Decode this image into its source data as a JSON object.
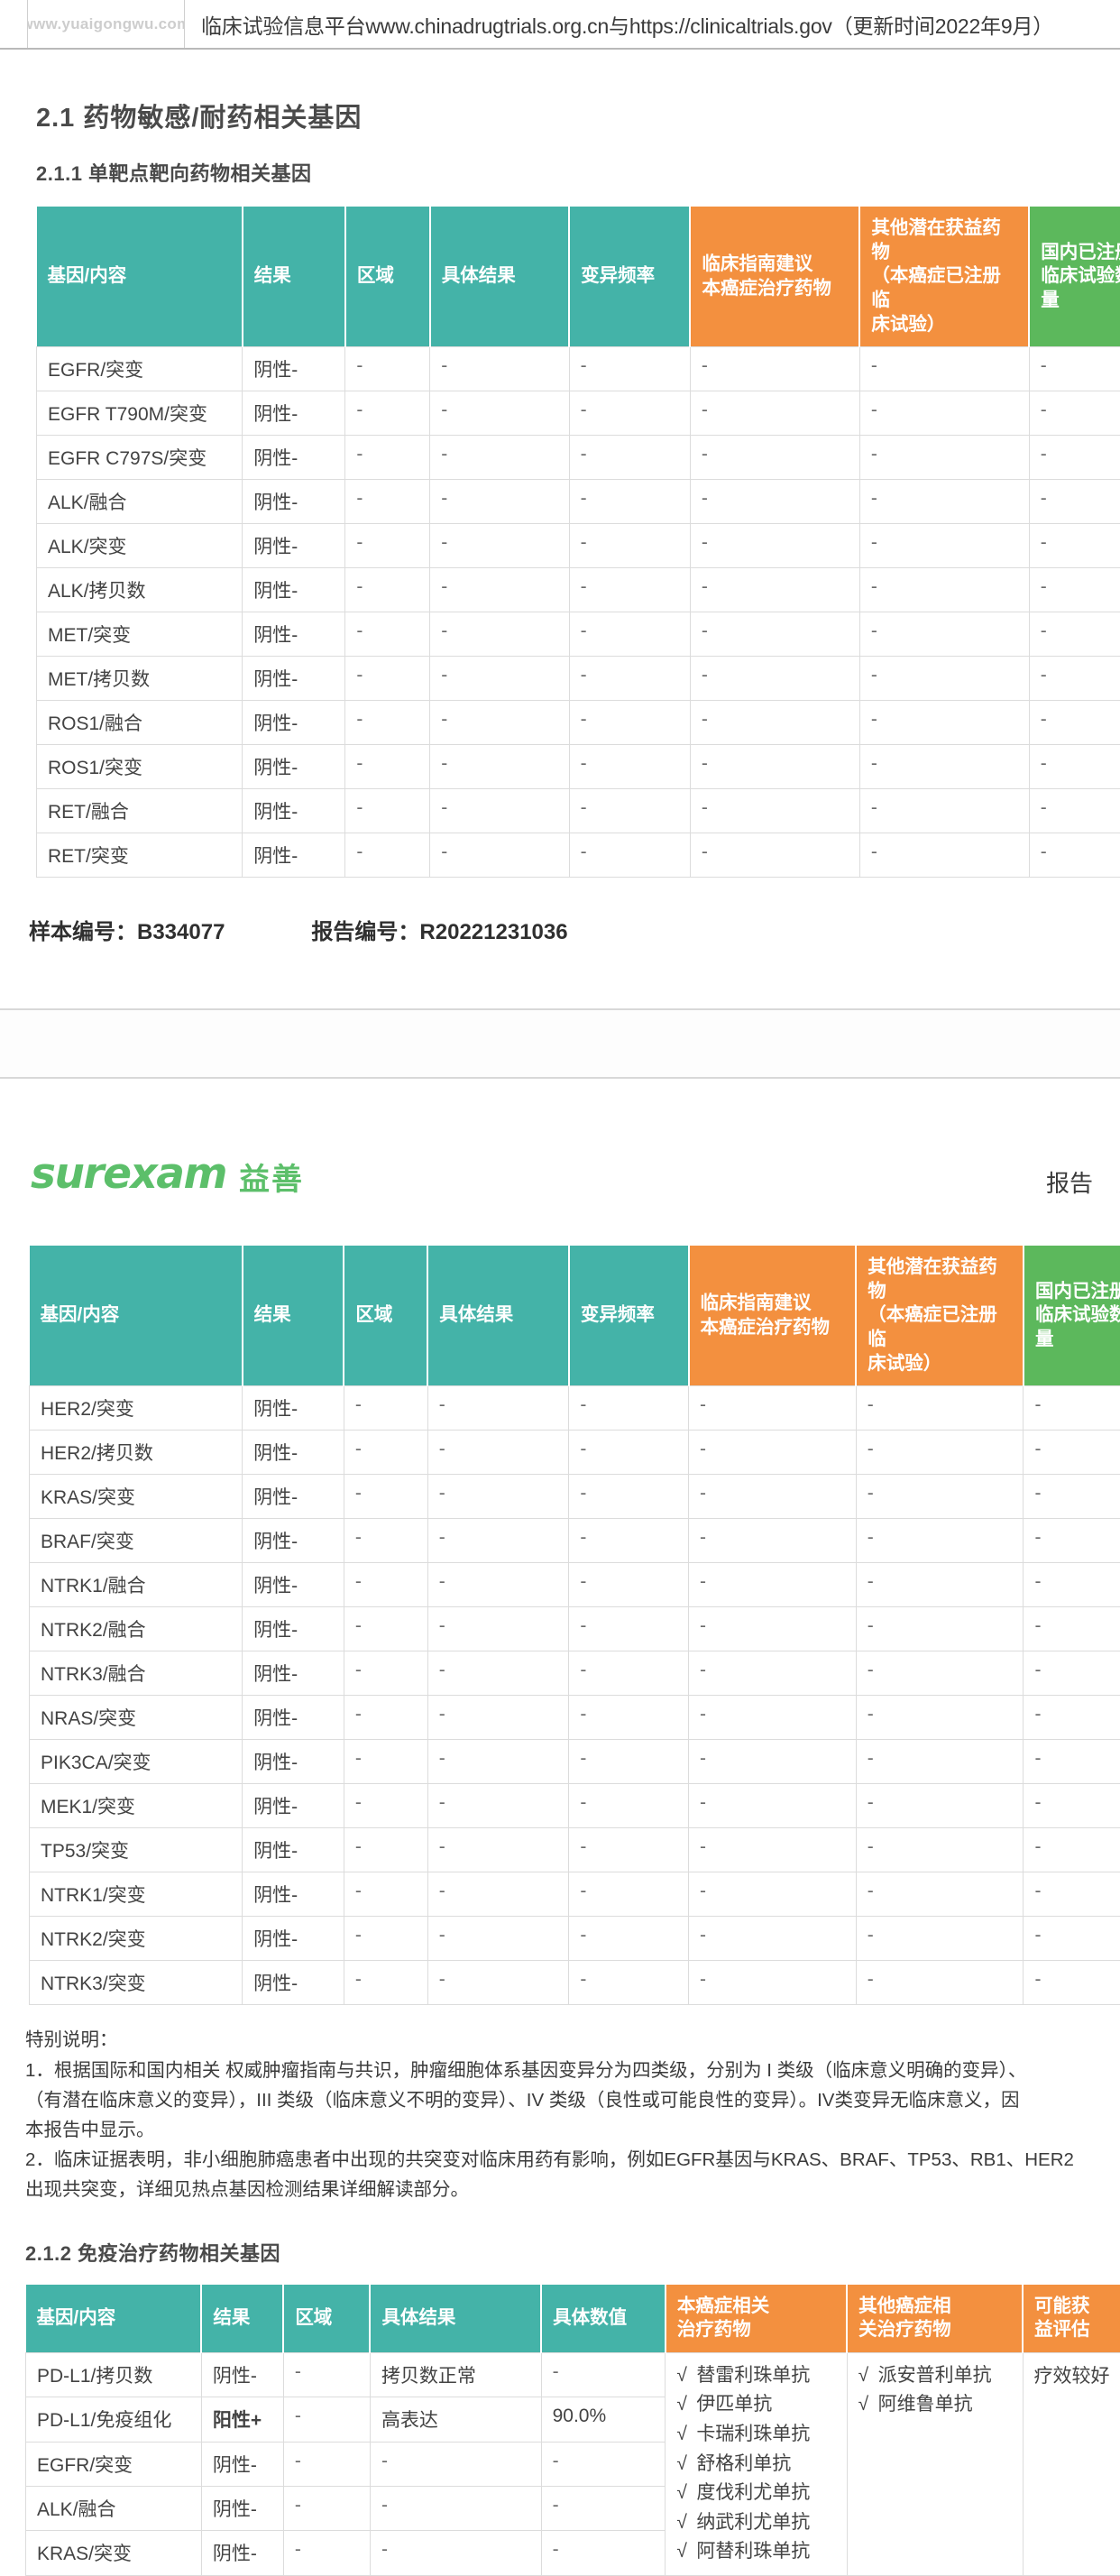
{
  "running_header": {
    "watermark": "www.yuaigongwu.com",
    "text": "临床试验信息平台www.chinadrugtrials.org.cn与https://clinicaltrials.gov（更新时间2022年9月）"
  },
  "section_2_1": {
    "title": "2.1  药物敏感/耐药相关基因",
    "subsection_title": "2.1.1  单靶点靶向药物相关基因",
    "columns": [
      "基因/内容",
      "结果",
      "区域",
      "具体结果",
      "变异频率",
      "临床指南建议\n本癌症治疗药物",
      "其他潜在获益药物（本癌症已注册临床试验）",
      "国内已注册\n临床试验数量"
    ],
    "column_labels": {
      "gene": "基因/内容",
      "result": "结果",
      "region": "区域",
      "detail": "具体结果",
      "freq": "变异频率",
      "guideline_l1": "临床指南建议",
      "guideline_l2": "本癌症治疗药物",
      "other_l1": "其他潜在获益药物",
      "other_l2": "（本癌症已注册临",
      "other_l3": "床试验）",
      "trials_l1": "国内已注册",
      "trials_l2": "临床试验数量"
    },
    "rows": [
      {
        "gene": "EGFR/突变",
        "result": "阴性-",
        "region": "-",
        "detail": "-",
        "freq": "-",
        "guideline": "-",
        "other": "-",
        "trials": "-"
      },
      {
        "gene": "EGFR T790M/突变",
        "result": "阴性-",
        "region": "-",
        "detail": "-",
        "freq": "-",
        "guideline": "-",
        "other": "-",
        "trials": "-"
      },
      {
        "gene": "EGFR C797S/突变",
        "result": "阴性-",
        "region": "-",
        "detail": "-",
        "freq": "-",
        "guideline": "-",
        "other": "-",
        "trials": "-"
      },
      {
        "gene": "ALK/融合",
        "result": "阴性-",
        "region": "-",
        "detail": "-",
        "freq": "-",
        "guideline": "-",
        "other": "-",
        "trials": "-"
      },
      {
        "gene": "ALK/突变",
        "result": "阴性-",
        "region": "-",
        "detail": "-",
        "freq": "-",
        "guideline": "-",
        "other": "-",
        "trials": "-"
      },
      {
        "gene": "ALK/拷贝数",
        "result": "阴性-",
        "region": "-",
        "detail": "-",
        "freq": "-",
        "guideline": "-",
        "other": "-",
        "trials": "-"
      },
      {
        "gene": "MET/突变",
        "result": "阴性-",
        "region": "-",
        "detail": "-",
        "freq": "-",
        "guideline": "-",
        "other": "-",
        "trials": "-"
      },
      {
        "gene": "MET/拷贝数",
        "result": "阴性-",
        "region": "-",
        "detail": "-",
        "freq": "-",
        "guideline": "-",
        "other": "-",
        "trials": "-"
      },
      {
        "gene": "ROS1/融合",
        "result": "阴性-",
        "region": "-",
        "detail": "-",
        "freq": "-",
        "guideline": "-",
        "other": "-",
        "trials": "-"
      },
      {
        "gene": "ROS1/突变",
        "result": "阴性-",
        "region": "-",
        "detail": "-",
        "freq": "-",
        "guideline": "-",
        "other": "-",
        "trials": "-"
      },
      {
        "gene": "RET/融合",
        "result": "阴性-",
        "region": "-",
        "detail": "-",
        "freq": "-",
        "guideline": "-",
        "other": "-",
        "trials": "-"
      },
      {
        "gene": "RET/突变",
        "result": "阴性-",
        "region": "-",
        "detail": "-",
        "freq": "-",
        "guideline": "-",
        "other": "-",
        "trials": "-"
      }
    ]
  },
  "ids": {
    "sample_label": "样本编号：",
    "sample_value": "B334077",
    "report_label": "报告编号：",
    "report_value": "R20221231036"
  },
  "brand": {
    "logo": "surexam",
    "logo_cn": "益善",
    "right_text": "报告"
  },
  "section_2_1_cont": {
    "rows": [
      {
        "gene": "HER2/突变",
        "result": "阴性-",
        "region": "-",
        "detail": "-",
        "freq": "-",
        "guideline": "-",
        "other": "-",
        "trials": "-"
      },
      {
        "gene": "HER2/拷贝数",
        "result": "阴性-",
        "region": "-",
        "detail": "-",
        "freq": "-",
        "guideline": "-",
        "other": "-",
        "trials": "-"
      },
      {
        "gene": "KRAS/突变",
        "result": "阴性-",
        "region": "-",
        "detail": "-",
        "freq": "-",
        "guideline": "-",
        "other": "-",
        "trials": "-"
      },
      {
        "gene": "BRAF/突变",
        "result": "阴性-",
        "region": "-",
        "detail": "-",
        "freq": "-",
        "guideline": "-",
        "other": "-",
        "trials": "-"
      },
      {
        "gene": "NTRK1/融合",
        "result": "阴性-",
        "region": "-",
        "detail": "-",
        "freq": "-",
        "guideline": "-",
        "other": "-",
        "trials": "-"
      },
      {
        "gene": "NTRK2/融合",
        "result": "阴性-",
        "region": "-",
        "detail": "-",
        "freq": "-",
        "guideline": "-",
        "other": "-",
        "trials": "-"
      },
      {
        "gene": "NTRK3/融合",
        "result": "阴性-",
        "region": "-",
        "detail": "-",
        "freq": "-",
        "guideline": "-",
        "other": "-",
        "trials": "-"
      },
      {
        "gene": "NRAS/突变",
        "result": "阴性-",
        "region": "-",
        "detail": "-",
        "freq": "-",
        "guideline": "-",
        "other": "-",
        "trials": "-"
      },
      {
        "gene": "PIK3CA/突变",
        "result": "阴性-",
        "region": "-",
        "detail": "-",
        "freq": "-",
        "guideline": "-",
        "other": "-",
        "trials": "-"
      },
      {
        "gene": "MEK1/突变",
        "result": "阴性-",
        "region": "-",
        "detail": "-",
        "freq": "-",
        "guideline": "-",
        "other": "-",
        "trials": "-"
      },
      {
        "gene": "TP53/突变",
        "result": "阴性-",
        "region": "-",
        "detail": "-",
        "freq": "-",
        "guideline": "-",
        "other": "-",
        "trials": "-"
      },
      {
        "gene": "NTRK1/突变",
        "result": "阴性-",
        "region": "-",
        "detail": "-",
        "freq": "-",
        "guideline": "-",
        "other": "-",
        "trials": "-"
      },
      {
        "gene": "NTRK2/突变",
        "result": "阴性-",
        "region": "-",
        "detail": "-",
        "freq": "-",
        "guideline": "-",
        "other": "-",
        "trials": "-"
      },
      {
        "gene": "NTRK3/突变",
        "result": "阴性-",
        "region": "-",
        "detail": "-",
        "freq": "-",
        "guideline": "-",
        "other": "-",
        "trials": "-"
      }
    ]
  },
  "notes": {
    "title": "特别说明：",
    "item1_l1": "1．根据国际和国内相关 权威肿瘤指南与共识，肿瘤细胞体系基因变异分为四类级，分别为 I 类级（临床意义明确的变异）、",
    "item1_l2": "（有潜在临床意义的变异），III 类级（临床意义不明的变异）、IV 类级（良性或可能良性的变异）。IV类变异无临床意义，因",
    "item1_l3": "本报告中显示。",
    "item2_l1": "2．临床证据表明，非小细胞肺癌患者中出现的共突变对临床用药有影响，例如EGFR基因与KRAS、BRAF、TP53、RB1、HER2",
    "item2_l2": "出现共突变，详细见热点基因检测结果详细解读部分。"
  },
  "section_2_1_2": {
    "title": "2.1.2  免疫治疗药物相关基因",
    "column_labels": {
      "gene": "基因/内容",
      "result": "结果",
      "region": "区域",
      "detail": "具体结果",
      "value": "具体数值",
      "this_cancer_l1": "本癌症相关",
      "this_cancer_l2": "治疗药物",
      "other_cancer_l1": "其他癌症相",
      "other_cancer_l2": "关治疗药物",
      "benefit_l1": "可能获",
      "benefit_l2": "益评估"
    },
    "rows": [
      {
        "gene": "PD-L1/拷贝数",
        "result": "阴性-",
        "result_positive": false,
        "region": "-",
        "detail": "拷贝数正常",
        "value": "-"
      },
      {
        "gene": "PD-L1/免疫组化",
        "result": "阳性+",
        "result_positive": true,
        "region": "-",
        "detail": "高表达",
        "value": "90.0%"
      },
      {
        "gene": "EGFR/突变",
        "result": "阴性-",
        "result_positive": false,
        "region": "-",
        "detail": "-",
        "value": "-"
      },
      {
        "gene": "ALK/融合",
        "result": "阴性-",
        "result_positive": false,
        "region": "-",
        "detail": "-",
        "value": "-"
      },
      {
        "gene": "KRAS/突变",
        "result": "阴性-",
        "result_positive": false,
        "region": "-",
        "detail": "-",
        "value": "-"
      }
    ],
    "this_cancer_drugs": [
      "替雷利珠单抗",
      "伊匹单抗",
      "卡瑞利珠单抗",
      "舒格利单抗",
      "度伐利尤单抗",
      "纳武利尤单抗",
      "阿替利珠单抗"
    ],
    "other_cancer_drugs": [
      "派安普利单抗",
      "阿维鲁单抗"
    ],
    "benefit": "疗效较好",
    "check_mark": "√"
  },
  "colors": {
    "teal": "#44b3a8",
    "orange": "#f3903f",
    "green": "#5cb85c",
    "positive_red": "#e8453c",
    "brand_green": "#5cbf6a"
  }
}
